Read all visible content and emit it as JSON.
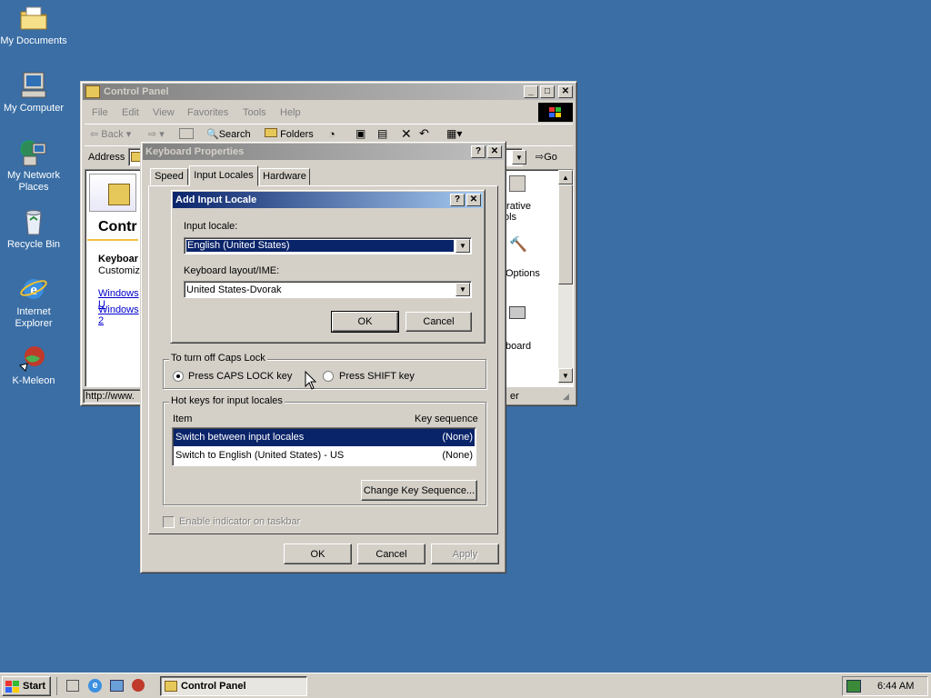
{
  "desktop": {
    "icons": [
      {
        "label": "My Documents",
        "icon": "folder-documents-icon"
      },
      {
        "label": "My Computer",
        "icon": "computer-icon"
      },
      {
        "label": "My Network Places",
        "icon": "network-icon"
      },
      {
        "label": "Recycle Bin",
        "icon": "recycle-bin-icon"
      },
      {
        "label": "Internet Explorer",
        "icon": "ie-icon"
      },
      {
        "label": "K-Meleon",
        "icon": "kmeleon-icon"
      }
    ]
  },
  "control_panel": {
    "title": "Control Panel",
    "menu": [
      "File",
      "Edit",
      "View",
      "Favorites",
      "Tools",
      "Help"
    ],
    "toolbar": {
      "back": "Back",
      "search": "Search",
      "folders": "Folders"
    },
    "address_label": "Address",
    "go": "Go",
    "left_title": "Contr",
    "left_heading": "Keyboar",
    "left_desc": "Customize",
    "left_links": [
      "Windows U",
      "Windows 2"
    ],
    "right_items": [
      "trative",
      "ols",
      "Options",
      "board"
    ],
    "status": "http://www.",
    "status_right": "er"
  },
  "keyboard_properties": {
    "title": "Keyboard Properties",
    "tabs": [
      "Speed",
      "Input Locales",
      "Hardware"
    ],
    "caps_group": "To turn off Caps Lock",
    "caps_options": [
      "Press CAPS LOCK key",
      "Press SHIFT key"
    ],
    "hotkeys_group": "Hot keys for input locales",
    "hotkeys_columns": [
      "Item",
      "Key sequence"
    ],
    "hotkeys_rows": [
      {
        "item": "Switch between input locales",
        "seq": "(None)"
      },
      {
        "item": "Switch to English (United States) - US",
        "seq": "(None)"
      }
    ],
    "change_key_button": "Change Key Sequence...",
    "enable_indicator": "Enable indicator on taskbar",
    "ok": "OK",
    "cancel": "Cancel",
    "apply": "Apply"
  },
  "add_input_locale": {
    "title": "Add Input Locale",
    "input_locale_label": "Input locale:",
    "input_locale_value": "English (United States)",
    "layout_label": "Keyboard layout/IME:",
    "layout_value": "United States-Dvorak",
    "ok": "OK",
    "cancel": "Cancel"
  },
  "taskbar": {
    "start": "Start",
    "task": "Control Panel",
    "clock": "6:44 AM"
  },
  "colors": {
    "desktop": "#3a6ea5",
    "title_active": "#0a246a",
    "face": "#d4d0c8"
  }
}
